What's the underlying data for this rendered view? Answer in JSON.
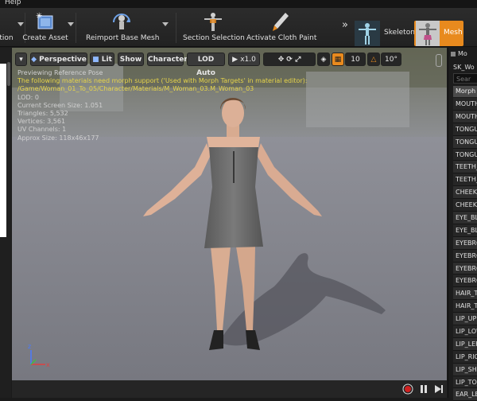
{
  "menu": {
    "help": "Help"
  },
  "toolbar": {
    "cut_label": "tion",
    "create_asset": "Create Asset",
    "reimport": "Reimport Base Mesh",
    "section_selection": "Section Selection",
    "cloth_paint": "Activate Cloth Paint",
    "mode_skeleton": "Skeleton",
    "mode_mesh": "Mesh",
    "accent": "#e88a1e"
  },
  "viewport": {
    "btn_perspective": "Perspective",
    "btn_lit": "Lit",
    "btn_show": "Show",
    "btn_character": "Character",
    "btn_lod": "LOD Auto",
    "btn_speed": "x1.0",
    "grid_value": "10",
    "angle_value": "10°",
    "info": {
      "line1": "Previewing Reference Pose",
      "line2": "The following materials need morph support ('Used with Morph Targets' in material editor):",
      "line3": "/Game/Woman_01_To_05/Character/Materials/M_Woman_03.M_Woman_03",
      "line4": "LOD: 0",
      "line5": "Current Screen Size: 1.051",
      "line6": "Triangles: 5,532",
      "line7": "Vertices: 3,561",
      "line8": "UV Channels: 1",
      "line9": "Approx Size: 118x46x177"
    },
    "axis_z": "z",
    "axis_x": "x"
  },
  "rightpanel": {
    "header": "Mo",
    "mesh_name": "SK_Wo",
    "search_placeholder": "Sear",
    "column": "Morph",
    "items": [
      "MOUTH_",
      "MOUTH_",
      "TONGUE",
      "TONGUE",
      "TONGUE",
      "TEETH_",
      "TEETH_",
      "CHEEK_",
      "CHEEK_",
      "EYE_BL",
      "EYE_BL",
      "EYEBRO",
      "EYEBRO",
      "EYEBRO",
      "EYEBRO",
      "HAIR_TO",
      "HAIR_TO",
      "LIP_UPP",
      "LIP_LOW",
      "LIP_LEF",
      "LIP_RIG",
      "LIP_SHI",
      "LIP_TO_",
      "EAR_LE"
    ]
  }
}
